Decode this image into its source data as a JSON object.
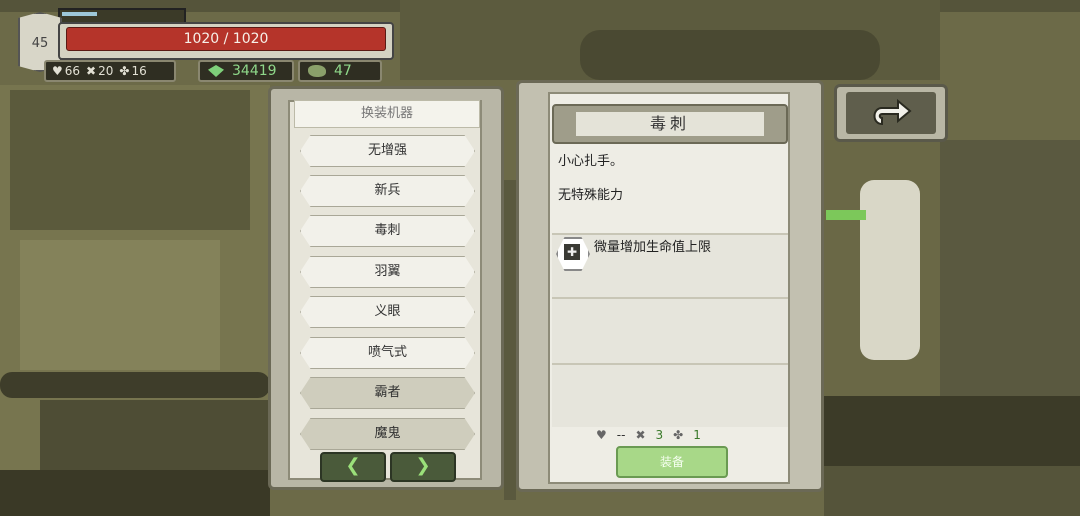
{
  "hud": {
    "level": "45",
    "hp_text": "1020 / 1020",
    "xp_progress": 0.3,
    "stats": [
      {
        "icon": "heart-icon",
        "value": "66"
      },
      {
        "icon": "crossed-wrench-icon",
        "value": "20"
      },
      {
        "icon": "clover-icon",
        "value": "16"
      }
    ],
    "gems": "34419",
    "ore": "47"
  },
  "left_panel": {
    "title": "换装机器",
    "items": [
      "无增强",
      "新兵",
      "毒刺",
      "羽翼",
      "义眼",
      "喷气式",
      "霸者",
      "魔鬼"
    ],
    "prev_icon": "chevron-left-icon",
    "next_icon": "chevron-right-icon"
  },
  "right_panel": {
    "title": "毒刺",
    "description": "小心扎手。",
    "ability": "无特殊能力",
    "perk_icon": "medkit-icon",
    "perk_text": "微量增加生命值上限",
    "bottom_stats": {
      "heart": "--",
      "wrench": "3",
      "clover": "1"
    },
    "equip_label": "装备"
  },
  "back_icon": "return-arrow-icon",
  "colors": {
    "hp": "#b5342a",
    "gem": "#7ed07a",
    "equip": "#a8d888",
    "background": "#6e6c4a"
  }
}
